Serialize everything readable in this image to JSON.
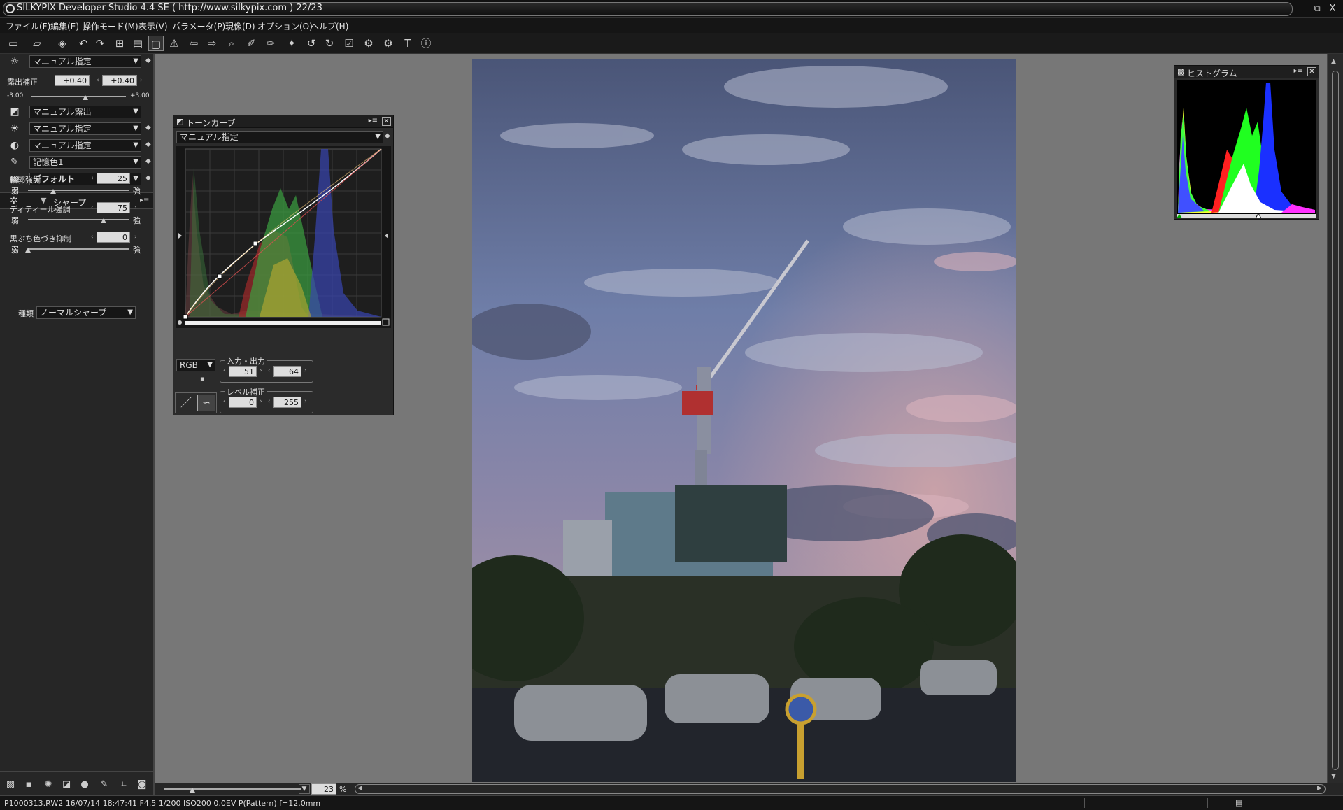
{
  "window": {
    "title": "SILKYPIX Developer Studio 4.4 SE ( http://www.silkypix.com )   22/23",
    "minimize": "_",
    "restore": "⧉",
    "close": "X"
  },
  "menu": [
    "ファイル(F)",
    "編集(E)",
    "操作モード(M)",
    "表示(V)",
    "パラメータ(P)",
    "現像(D)",
    "オプション(O)",
    "ヘルプ(H)"
  ],
  "toolbar_icons": [
    "open-folder-icon",
    "open-recent-icon",
    "eraser-icon",
    "undo-icon",
    "redo-icon",
    "grid-view-icon",
    "filmstrip-view-icon",
    "single-view-icon",
    "warning-icon",
    "prev-image-icon",
    "next-image-icon",
    "zoom-icon",
    "eyedropper-wb-icon",
    "eyedropper-gray-icon",
    "spot-icon",
    "rotate-left-icon",
    "rotate-right-icon",
    "mark-icon",
    "develop-icon",
    "develop-all-icon",
    "text-icon",
    "info-icon"
  ],
  "left_panel": {
    "rows": [
      {
        "icon": "gear-icon",
        "glyph": "☼",
        "value": "マニュアル指定"
      },
      {
        "icon": "exposure-icon",
        "glyph": "◩",
        "value": "マニュアル露出"
      },
      {
        "icon": "white-balance-icon",
        "glyph": "☀",
        "value": "マニュアル指定"
      },
      {
        "icon": "contrast-icon",
        "glyph": "◐",
        "value": "マニュアル指定"
      },
      {
        "icon": "color-pen-icon",
        "glyph": "✎",
        "value": "記憶色1"
      },
      {
        "icon": "style-icon",
        "glyph": "▨",
        "value": "デフォルト"
      }
    ],
    "exposure": {
      "label": "露出補正",
      "value1": "+0.40",
      "value2": "+0.40",
      "min": "-3.00",
      "max": "+3.00",
      "level": 0.57
    },
    "sharp": {
      "section": "シャープ",
      "sliders": [
        {
          "label": "輪郭強調",
          "value": "25",
          "low": "弱",
          "high": "強",
          "level": 0.25
        },
        {
          "label": "ディティール強調",
          "value": "75",
          "low": "弱",
          "high": "強",
          "level": 0.75
        },
        {
          "label": "黒ぶち色づき抑制",
          "value": "0",
          "low": "弱",
          "high": "強",
          "level": 0.0
        }
      ],
      "type_label": "種類",
      "type_value": "ノーマルシャープ"
    }
  },
  "tone_curve": {
    "title": "トーンカーブ",
    "preset": "マニュアル指定",
    "channel": "RGB",
    "io_label": "入力・出力",
    "input": "51",
    "output": "64",
    "level_label": "レベル補正",
    "level_low": "0",
    "level_high": "255"
  },
  "histogram": {
    "title": "ヒストグラム"
  },
  "zoom": {
    "value": "23",
    "unit": "%"
  },
  "status": "P1000313.RW2  16/07/14  18:47:41  F4.5  1/200  ISO200   0.0EV  P(Pattern)  f=12.0mm",
  "colors": {
    "background": "#777777",
    "panel": "#262626",
    "titlebar": "#111111"
  }
}
